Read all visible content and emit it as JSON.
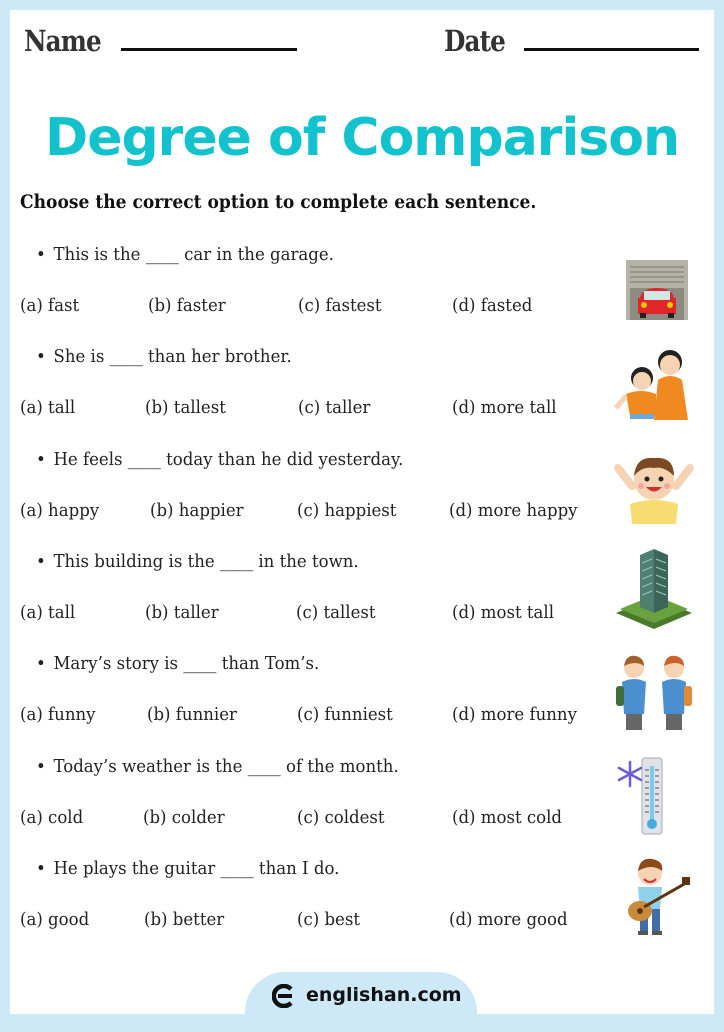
{
  "header": {
    "name_label": "Name",
    "date_label": "Date"
  },
  "title": "Degree of Comparison",
  "instruction": "Choose the correct option to complete each sentence.",
  "questions": [
    {
      "sentence": "This is the ____ car in the garage.",
      "options": [
        "(a) fast",
        "(b) faster",
        "(c) fastest",
        "(d) fasted"
      ],
      "image": "garage-car-icon"
    },
    {
      "sentence": "She is ____ than her brother.",
      "options": [
        "(a) tall",
        "(b) tallest",
        "(c) taller",
        "(d) more tall"
      ],
      "image": "siblings-icon"
    },
    {
      "sentence": "He feels ____ today than he did yesterday.",
      "options": [
        "(a) happy",
        "(b) happier",
        "(c) happiest",
        "(d) more happy"
      ],
      "image": "happy-boy-icon"
    },
    {
      "sentence": "This building is the ____ in the town.",
      "options": [
        "(a) tall",
        "(b) taller",
        "(c) tallest",
        "(d) most tall"
      ],
      "image": "building-icon"
    },
    {
      "sentence": "Mary’s story is ____ than Tom’s.",
      "options": [
        "(a) funny",
        "(b) funnier",
        "(c) funniest",
        "(d) more funny"
      ],
      "image": "two-kids-talking-icon"
    },
    {
      "sentence": "Today’s weather is the ____ of the month.",
      "options": [
        "(a) cold",
        "(b) colder",
        "(c) coldest",
        "(d) most cold"
      ],
      "image": "thermometer-snowflake-icon"
    },
    {
      "sentence": "He plays the guitar ____ than I do.",
      "options": [
        "(a) good",
        "(b) better",
        "(c) best",
        "(d) more good"
      ],
      "image": "boy-guitar-icon"
    }
  ],
  "footer": {
    "site": "englishan.com"
  },
  "colors": {
    "border": "#cde8f6",
    "title": "#12c2cc"
  }
}
